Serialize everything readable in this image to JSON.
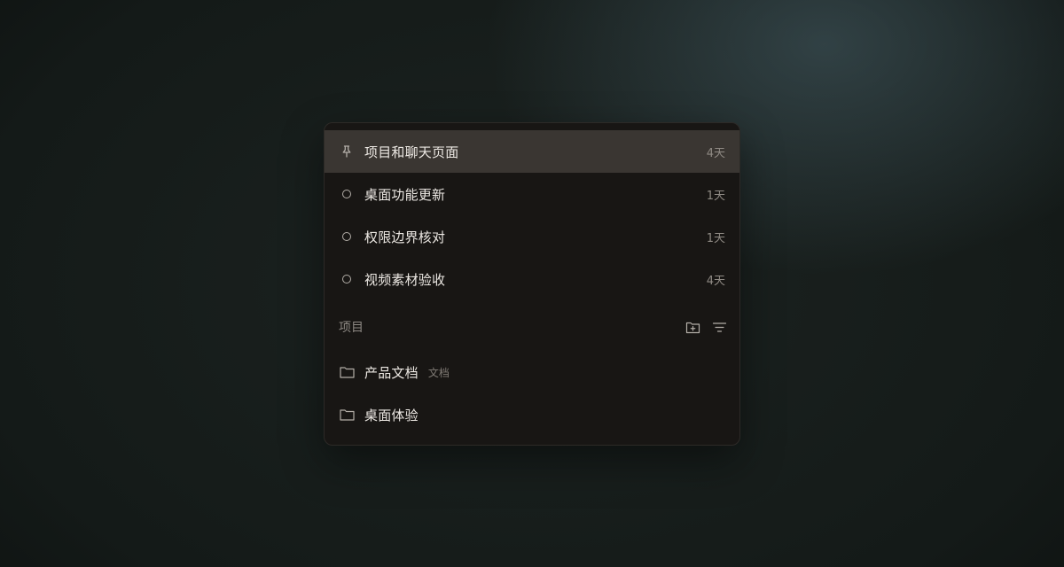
{
  "tasks": [
    {
      "title": "项目和聊天页面",
      "age": "4天",
      "icon": "pin-icon",
      "active": true
    },
    {
      "title": "桌面功能更新",
      "age": "1天",
      "icon": "circle-icon",
      "active": false
    },
    {
      "title": "权限边界核对",
      "age": "1天",
      "icon": "circle-icon",
      "active": false
    },
    {
      "title": "视频素材验收",
      "age": "4天",
      "icon": "circle-icon",
      "active": false
    }
  ],
  "projects_section": {
    "label": "项目",
    "actions": [
      "new-folder-icon",
      "filter-icon"
    ]
  },
  "projects": [
    {
      "name": "产品文档",
      "tag": "文档",
      "icon": "folder-icon"
    },
    {
      "name": "桌面体验",
      "tag": "",
      "icon": "folder-icon"
    }
  ],
  "colors": {
    "panel_bg": "#181614",
    "active_row_bg": "#3a3632",
    "text_primary": "#ece8e3",
    "text_muted": "#8f8a84"
  }
}
